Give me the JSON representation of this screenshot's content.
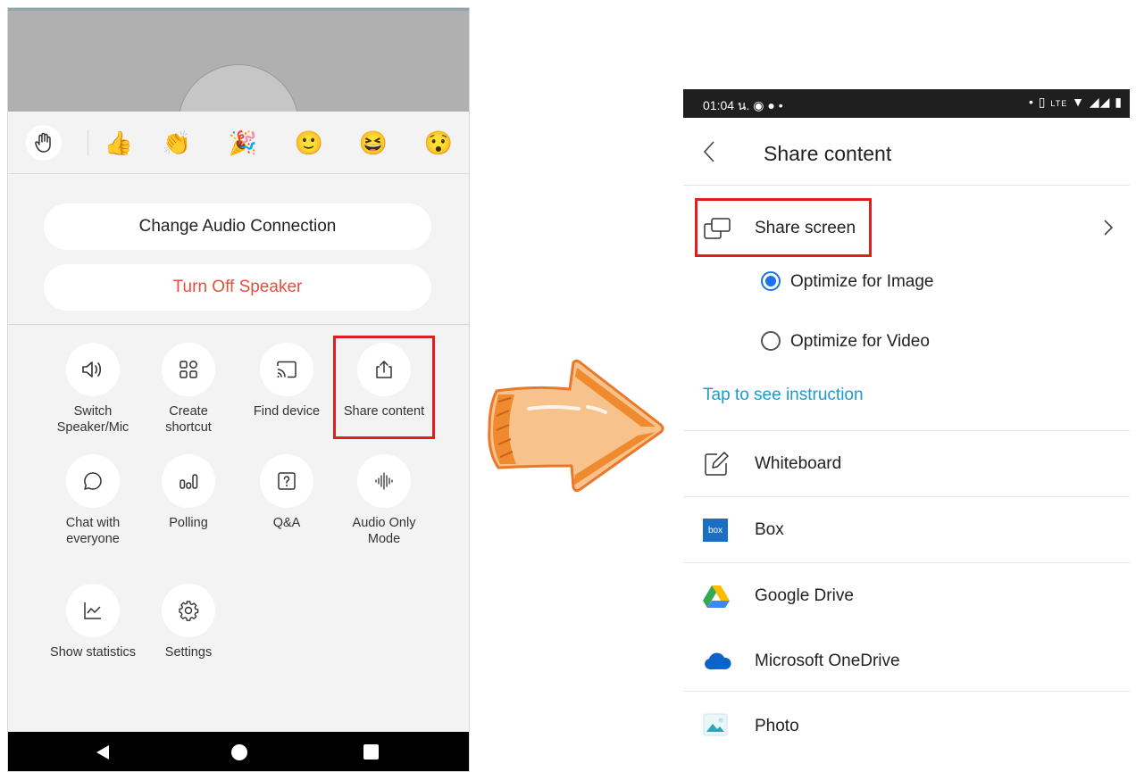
{
  "left_panel": {
    "reactions": [
      "👍",
      "👏",
      "🎉",
      "🙂",
      "😆",
      "😯"
    ],
    "change_audio_label": "Change Audio Connection",
    "turn_off_speaker_label": "Turn Off Speaker",
    "grid": [
      {
        "label": "Switch\nSpeaker/Mic",
        "icon": "speaker-icon"
      },
      {
        "label": "Create\nshortcut",
        "icon": "shortcut-grid-icon"
      },
      {
        "label": "Find device",
        "icon": "cast-icon"
      },
      {
        "label": "Share content",
        "icon": "share-upload-icon"
      },
      {
        "label": "Chat with\neveryone",
        "icon": "chat-icon"
      },
      {
        "label": "Polling",
        "icon": "polling-icon"
      },
      {
        "label": "Q&A",
        "icon": "question-icon"
      },
      {
        "label": "Audio Only\nMode",
        "icon": "audio-wave-icon"
      },
      {
        "label": "Show statistics",
        "icon": "statistics-icon"
      },
      {
        "label": "Settings",
        "icon": "gear-icon"
      }
    ]
  },
  "right_panel": {
    "status_time": "01:04 น.",
    "header_title": "Share content",
    "share_screen_label": "Share screen",
    "options": [
      "Optimize for Image",
      "Optimize for Video"
    ],
    "selected_option": "Optimize for Image",
    "instruction_link": "Tap to see instruction",
    "items": [
      {
        "label": "Whiteboard",
        "icon": "whiteboard-icon"
      },
      {
        "label": "Box",
        "icon": "box-icon",
        "badge": "box"
      },
      {
        "label": "Google Drive",
        "icon": "google-drive-icon"
      },
      {
        "label": "Microsoft OneDrive",
        "icon": "onedrive-icon"
      },
      {
        "label": "Photo",
        "icon": "photo-icon"
      }
    ]
  },
  "colors": {
    "highlight_red": "#e01e1e",
    "speaker_red": "#e2513f",
    "link_blue": "#1a9bd1",
    "radio_blue": "#1a73e8",
    "arrow_orange": "#f28a2e"
  }
}
